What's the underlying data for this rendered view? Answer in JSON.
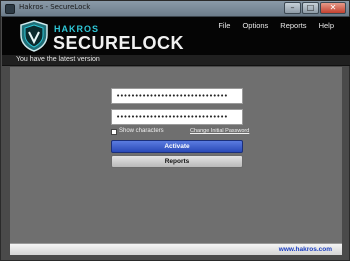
{
  "window": {
    "title": "Hakros - SecureLock",
    "buttons": {
      "minimize": "–",
      "maximize": "□",
      "close": "✕"
    }
  },
  "header": {
    "brand_top": "HAKROS",
    "brand_main": "SECURELOCK",
    "menu": [
      "File",
      "Options",
      "Reports",
      "Help"
    ]
  },
  "status": {
    "message": "You have the latest version"
  },
  "form": {
    "password1": "••••••••••••••••••••••••••••••",
    "password2": "••••••••••••••••••••••••••••••",
    "show_characters": "Show characters",
    "change_password": "Change Initial Password",
    "activate": "Activate",
    "reports": "Reports"
  },
  "footer": {
    "link": "www.hakros.com"
  },
  "colors": {
    "accent": "#2ec6d6",
    "activate": "#2a4ab8",
    "link": "#1a3dbf"
  }
}
